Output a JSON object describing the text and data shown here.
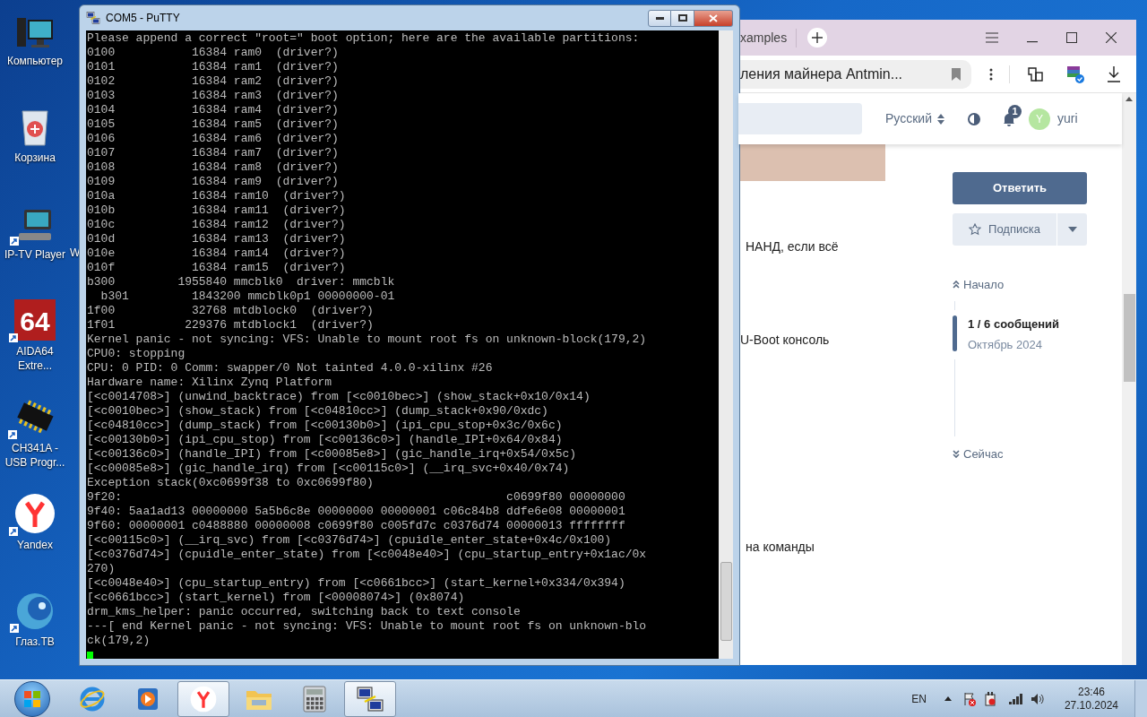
{
  "desktop": {
    "icons": [
      {
        "kind": "computer",
        "lines": [
          "Компьютер"
        ]
      },
      {
        "kind": "recycle-bin",
        "lines": [
          "Корзина"
        ]
      },
      {
        "kind": "tv",
        "lines": [
          "IP-TV Player"
        ],
        "shortcut": true
      },
      {
        "kind": "aida",
        "logo_text": "64",
        "lines": [
          "AIDA64",
          "Extre..."
        ],
        "shortcut": true
      },
      {
        "kind": "chip",
        "lines": [
          "CH341A -",
          "USB Progr..."
        ],
        "shortcut": true
      },
      {
        "kind": "yandex",
        "lines": [
          "Yandex"
        ],
        "shortcut": true
      },
      {
        "kind": "glaz",
        "lines": [
          "Глаз.ТВ"
        ],
        "shortcut": true
      }
    ],
    "hidden_icon_label": "W"
  },
  "putty": {
    "title": "COM5 - PuTTY",
    "lines": [
      "Please append a correct \"root=\" boot option; here are the available partitions:",
      "0100           16384 ram0  (driver?)",
      "0101           16384 ram1  (driver?)",
      "0102           16384 ram2  (driver?)",
      "0103           16384 ram3  (driver?)",
      "0104           16384 ram4  (driver?)",
      "0105           16384 ram5  (driver?)",
      "0106           16384 ram6  (driver?)",
      "0107           16384 ram7  (driver?)",
      "0108           16384 ram8  (driver?)",
      "0109           16384 ram9  (driver?)",
      "010a           16384 ram10  (driver?)",
      "010b           16384 ram11  (driver?)",
      "010c           16384 ram12  (driver?)",
      "010d           16384 ram13  (driver?)",
      "010e           16384 ram14  (driver?)",
      "010f           16384 ram15  (driver?)",
      "b300         1955840 mmcblk0  driver: mmcblk",
      "  b301         1843200 mmcblk0p1 00000000-01",
      "1f00           32768 mtdblock0  (driver?)",
      "1f01          229376 mtdblock1  (driver?)",
      "Kernel panic - not syncing: VFS: Unable to mount root fs on unknown-block(179,2)",
      "CPU0: stopping",
      "CPU: 0 PID: 0 Comm: swapper/0 Not tainted 4.0.0-xilinx #26",
      "Hardware name: Xilinx Zynq Platform",
      "[<c0014708>] (unwind_backtrace) from [<c0010bec>] (show_stack+0x10/0x14)",
      "[<c0010bec>] (show_stack) from [<c04810cc>] (dump_stack+0x90/0xdc)",
      "[<c04810cc>] (dump_stack) from [<c00130b0>] (ipi_cpu_stop+0x3c/0x6c)",
      "[<c00130b0>] (ipi_cpu_stop) from [<c00136c0>] (handle_IPI+0x64/0x84)",
      "[<c00136c0>] (handle_IPI) from [<c00085e8>] (gic_handle_irq+0x54/0x5c)",
      "[<c00085e8>] (gic_handle_irq) from [<c00115c0>] (__irq_svc+0x40/0x74)",
      "Exception stack(0xc0699f38 to 0xc0699f80)",
      "9f20:                                                       c0699f80 00000000",
      "9f40: 5aa1ad13 00000000 5a5b6c8e 00000000 00000001 c06c84b8 ddfe6e08 00000001",
      "9f60: 00000001 c0488880 00000008 c0699f80 c005fd7c c0376d74 00000013 ffffffff",
      "[<c00115c0>] (__irq_svc) from [<c0376d74>] (cpuidle_enter_state+0x4c/0x100)",
      "[<c0376d74>] (cpuidle_enter_state) from [<c0048e40>] (cpu_startup_entry+0x1ac/0x",
      "270)",
      "[<c0048e40>] (cpu_startup_entry) from [<c0661bcc>] (start_kernel+0x334/0x394)",
      "[<c0661bcc>] (start_kernel) from [<00008074>] (0x8074)",
      "drm_kms_helper: panic occurred, switching back to text console",
      "---[ end Kernel panic - not syncing: VFS: Unable to mount root fs on unknown-blo",
      "ck(179,2)"
    ]
  },
  "browser": {
    "tab_title": "xamples",
    "address": "ления майнера Antmin...",
    "header": {
      "language": "Русский",
      "notifications": "1",
      "avatar_letter": "Y",
      "username": "yuri"
    },
    "texts": [
      "НАНД, если всё",
      "U-Boot консоль",
      "на команды"
    ],
    "reply_button": "Ответить",
    "subscribe_button": "Подписка",
    "timeline": {
      "start": "Начало",
      "position": "1 / 6 сообщений",
      "date": "Октябрь 2024",
      "end": "Сейчас"
    }
  },
  "taskbar": {
    "items": [
      {
        "kind": "ie",
        "active": false
      },
      {
        "kind": "media",
        "active": false
      },
      {
        "kind": "yandex",
        "active": true
      },
      {
        "kind": "explorer",
        "active": false
      },
      {
        "kind": "calculator",
        "active": false
      },
      {
        "kind": "putty",
        "active": true
      }
    ],
    "language": "EN",
    "time": "23:46",
    "date": "27.10.2024"
  }
}
